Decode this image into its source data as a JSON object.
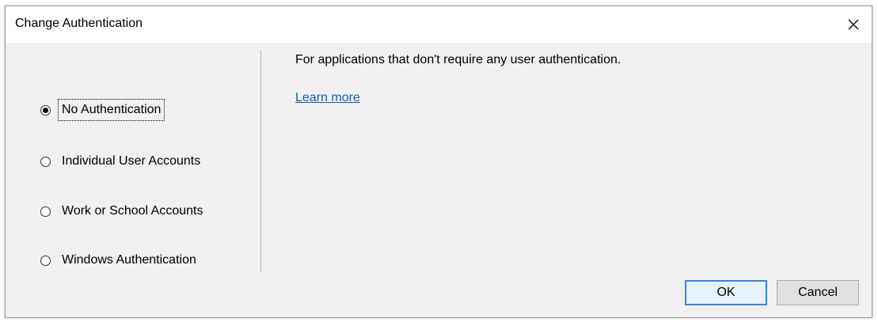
{
  "window": {
    "title": "Change Authentication",
    "close_icon": "close-icon"
  },
  "auth_options": [
    {
      "label": "No Authentication",
      "selected": true
    },
    {
      "label": "Individual User Accounts",
      "selected": false
    },
    {
      "label": "Work or School Accounts",
      "selected": false
    },
    {
      "label": "Windows Authentication",
      "selected": false
    }
  ],
  "details": {
    "description": "For applications that don't require any user authentication.",
    "learn_more": "Learn more"
  },
  "buttons": {
    "ok": "OK",
    "cancel": "Cancel"
  },
  "colors": {
    "link": "#1a5fb4",
    "primary_border": "#3a86d8"
  }
}
